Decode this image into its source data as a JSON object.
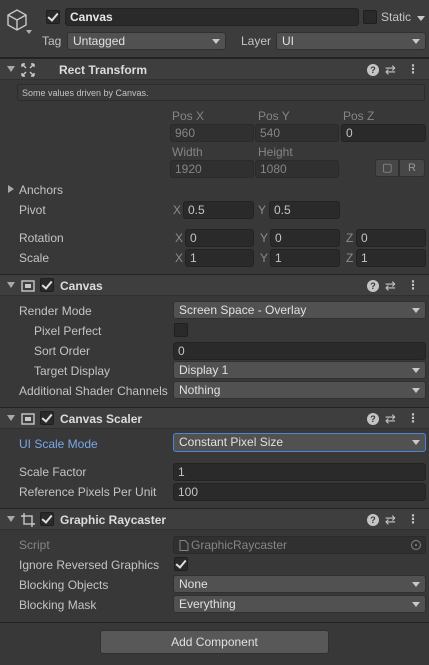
{
  "gameobject": {
    "name": "Canvas",
    "active": true,
    "static_label": "Static",
    "static_checked": false,
    "tag_label": "Tag",
    "tag_value": "Untagged",
    "layer_label": "Layer",
    "layer_value": "UI"
  },
  "rect_transform": {
    "title": "Rect Transform",
    "info": "Some values driven by Canvas.",
    "col_headers_1": [
      "Pos X",
      "Pos Y",
      "Pos Z"
    ],
    "values_1": [
      "960",
      "540",
      "0"
    ],
    "col_headers_2": [
      "Width",
      "Height"
    ],
    "values_2": [
      "1920",
      "1080"
    ],
    "blueprint_btn": "▢",
    "raw_btn": "R",
    "anchors_label": "Anchors",
    "pivot_label": "Pivot",
    "pivot_axes": [
      "X",
      "Y"
    ],
    "pivot_values": [
      "0.5",
      "0.5"
    ],
    "rotation_label": "Rotation",
    "rotation_axes": [
      "X",
      "Y",
      "Z"
    ],
    "rotation_values": [
      "0",
      "0",
      "0"
    ],
    "scale_label": "Scale",
    "scale_axes": [
      "X",
      "Y",
      "Z"
    ],
    "scale_values": [
      "1",
      "1",
      "1"
    ]
  },
  "canvas": {
    "title": "Canvas",
    "enabled": true,
    "render_mode_label": "Render Mode",
    "render_mode_value": "Screen Space - Overlay",
    "pixel_perfect_label": "Pixel Perfect",
    "pixel_perfect": false,
    "sort_order_label": "Sort Order",
    "sort_order_value": "0",
    "target_display_label": "Target Display",
    "target_display_value": "Display 1",
    "shader_channels_label": "Additional Shader Channels",
    "shader_channels_value": "Nothing"
  },
  "canvas_scaler": {
    "title": "Canvas Scaler",
    "scale_mode_label": "UI Scale Mode",
    "scale_mode_value": "Constant Pixel Size",
    "scale_factor_label": "Scale Factor",
    "scale_factor_value": "1",
    "ref_ppu_label": "Reference Pixels Per Unit",
    "ref_ppu_value": "100"
  },
  "raycaster": {
    "title": "Graphic Raycaster",
    "enabled": true,
    "script_label": "Script",
    "script_value": "GraphicRaycaster",
    "ignore_reversed_label": "Ignore Reversed Graphics",
    "ignore_reversed": true,
    "blocking_objects_label": "Blocking Objects",
    "blocking_objects_value": "None",
    "blocking_mask_label": "Blocking Mask",
    "blocking_mask_value": "Everything"
  },
  "header_icons": {
    "help": "?",
    "preset": "⇄",
    "menu": "⋮"
  },
  "add_component_label": "Add Component",
  "colors": {
    "background": "#383838",
    "header": "#3e3e3e",
    "field": "#2a2a2a",
    "accent_label": "#7aa6e8"
  }
}
